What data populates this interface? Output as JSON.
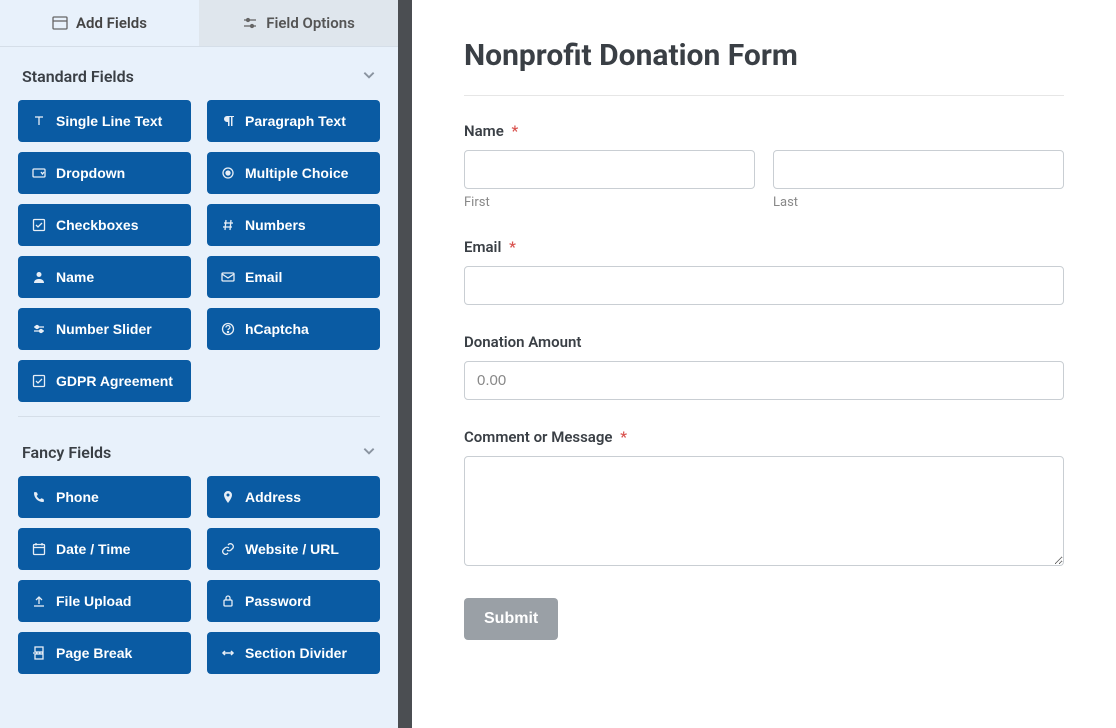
{
  "tabs": {
    "add_fields": "Add Fields",
    "field_options": "Field Options"
  },
  "sections": {
    "standard": {
      "title": "Standard Fields",
      "fields": [
        {
          "icon": "text-icon",
          "label": "Single Line Text"
        },
        {
          "icon": "paragraph-icon",
          "label": "Paragraph Text"
        },
        {
          "icon": "dropdown-icon",
          "label": "Dropdown"
        },
        {
          "icon": "radio-icon",
          "label": "Multiple Choice"
        },
        {
          "icon": "checkbox-icon",
          "label": "Checkboxes"
        },
        {
          "icon": "hash-icon",
          "label": "Numbers"
        },
        {
          "icon": "person-icon",
          "label": "Name"
        },
        {
          "icon": "envelope-icon",
          "label": "Email"
        },
        {
          "icon": "slider-icon",
          "label": "Number Slider"
        },
        {
          "icon": "question-icon",
          "label": "hCaptcha"
        },
        {
          "icon": "check-icon",
          "label": "GDPR Agreement"
        }
      ]
    },
    "fancy": {
      "title": "Fancy Fields",
      "fields": [
        {
          "icon": "phone-icon",
          "label": "Phone"
        },
        {
          "icon": "pin-icon",
          "label": "Address"
        },
        {
          "icon": "calendar-icon",
          "label": "Date / Time"
        },
        {
          "icon": "link-icon",
          "label": "Website / URL"
        },
        {
          "icon": "upload-icon",
          "label": "File Upload"
        },
        {
          "icon": "lock-icon",
          "label": "Password"
        },
        {
          "icon": "pagebreak-icon",
          "label": "Page Break"
        },
        {
          "icon": "divider-icon",
          "label": "Section Divider"
        }
      ]
    }
  },
  "form": {
    "title": "Nonprofit Donation Form",
    "name_label": "Name",
    "first_sub": "First",
    "last_sub": "Last",
    "email_label": "Email",
    "donation_label": "Donation Amount",
    "donation_placeholder": "0.00",
    "comment_label": "Comment or Message",
    "submit_label": "Submit",
    "required_mark": "*"
  }
}
